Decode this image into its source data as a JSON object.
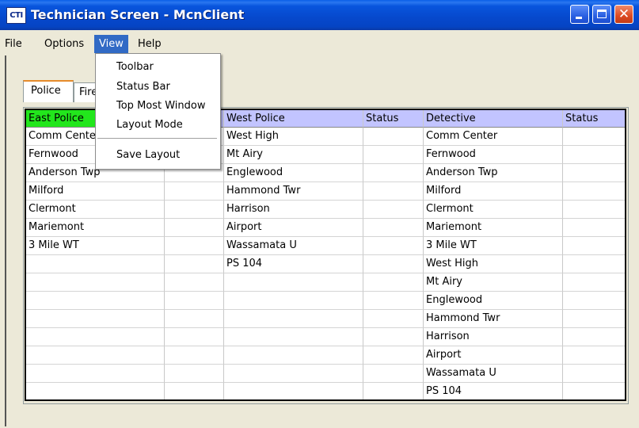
{
  "window": {
    "icon_text": "CTI",
    "title": "Technician Screen - McnClient",
    "controls": [
      "minimize-icon",
      "maximize-icon",
      "close-icon"
    ]
  },
  "menubar": {
    "items": [
      "File",
      "Options",
      "View",
      "Help"
    ],
    "active": "View"
  },
  "view_menu": {
    "items": [
      "Toolbar",
      "Status Bar",
      "Top Most Window",
      "Layout Mode",
      "Save Layout"
    ]
  },
  "tabs": {
    "items": [
      "Police",
      "Fire"
    ],
    "selected": "Police"
  },
  "grid": {
    "headers": [
      "East Police",
      "",
      "West Police",
      "Status",
      "Detective",
      "Status"
    ],
    "header_color": "#c2c4ff",
    "highlight_header_color": "#22e61c",
    "col1": [
      "Comm Center",
      "Fernwood",
      "Anderson Twp",
      "Milford",
      "Clermont",
      "Mariemont",
      "3 Mile WT"
    ],
    "col3": [
      "West High",
      "Mt Airy",
      "Englewood",
      "Hammond Twr",
      "Harrison",
      "Airport",
      "Wassamata U",
      "PS 104"
    ],
    "col5": [
      "Comm Center",
      "Fernwood",
      "Anderson Twp",
      "Milford",
      "Clermont",
      "Mariemont",
      "3 Mile WT",
      "West High",
      "Mt Airy",
      "Englewood",
      "Hammond Twr",
      "Harrison",
      "Airport",
      "Wassamata U",
      "PS 104"
    ]
  }
}
